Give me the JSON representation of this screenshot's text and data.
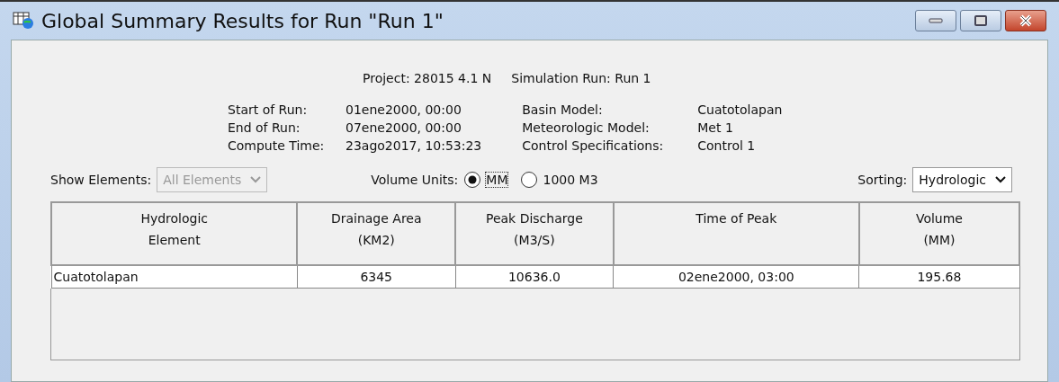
{
  "window": {
    "title": "Global Summary Results for Run \"Run 1\""
  },
  "header": {
    "project": "Project: 28015 4.1 N",
    "simulation_run": "Simulation Run: Run 1"
  },
  "run_info": [
    {
      "label": "Start of Run:",
      "value": "01ene2000, 00:00"
    },
    {
      "label": "End of Run:",
      "value": "07ene2000, 00:00"
    },
    {
      "label": "Compute Time:",
      "value": "23ago2017, 10:53:23"
    }
  ],
  "model_info": [
    {
      "label": "Basin Model:",
      "value": "Cuatotolapan"
    },
    {
      "label": "Meteorologic Model:",
      "value": "Met 1"
    },
    {
      "label": "Control Specifications:",
      "value": "Control 1"
    }
  ],
  "show_elements": {
    "label": "Show Elements:",
    "value": "All Elements",
    "disabled": true
  },
  "volume_units": {
    "label": "Volume Units:",
    "options": [
      {
        "label": "MM",
        "selected": true
      },
      {
        "label": "1000 M3",
        "selected": false
      }
    ]
  },
  "sorting": {
    "label": "Sorting:",
    "value": "Hydrologic",
    "disabled": false
  },
  "table": {
    "columns": [
      "Hydrologic\nElement",
      "Drainage Area\n(KM2)",
      "Peak Discharge\n(M3/S)",
      "Time of Peak",
      "Volume\n(MM)"
    ],
    "rows": [
      [
        "Cuatotolapan",
        "6345",
        "10636.0",
        "02ene2000, 03:00",
        "195.68"
      ]
    ]
  }
}
